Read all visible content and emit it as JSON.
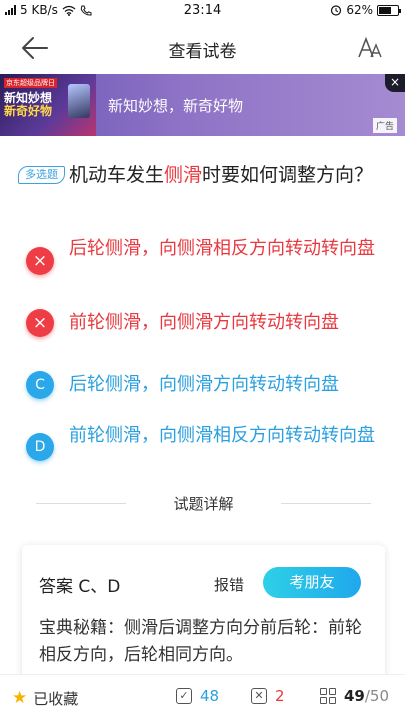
{
  "status_bar": {
    "network": "5 KB/s",
    "time": "23:14",
    "battery": "62%"
  },
  "header": {
    "title": "查看试卷"
  },
  "ad": {
    "thumb_tag": "京东超级品牌日",
    "thumb_line1": "新知妙想",
    "thumb_line2": "新奇好物",
    "text": "新知妙想，新奇好物",
    "label": "广告",
    "close": "×"
  },
  "question": {
    "type_badge": "多选题",
    "text_before": "机动车发生",
    "highlight": "侧滑",
    "text_after": "时要如何调整方向？"
  },
  "options": [
    {
      "marker": "×",
      "text": "后轮侧滑，向侧滑相反方向转动转向盘",
      "state": "wrong"
    },
    {
      "marker": "×",
      "text": "前轮侧滑，向侧滑方向转动转向盘",
      "state": "wrong"
    },
    {
      "marker": "C",
      "text": "后轮侧滑，向侧滑方向转动转向盘",
      "state": "plain"
    },
    {
      "marker": "D",
      "text": "前轮侧滑，向侧滑相反方向转动转向盘",
      "state": "plain"
    }
  ],
  "detail_divider": "试题详解",
  "explanation": {
    "answer": "答案  C、D",
    "report_label": "报错",
    "friend_button": "考朋友",
    "tips_title": "宝典秘籍：",
    "tips_text": "侧滑后调整方向分前后轮：前轮相反方向，后轮相同方向。"
  },
  "bottom_bar": {
    "favorite_label": "已收藏",
    "correct_count": "48",
    "wrong_count": "2",
    "progress_current": "49",
    "progress_total": "/50"
  },
  "colors": {
    "wrong": "#e7393f",
    "primary": "#2aa0de",
    "star": "#f5b400"
  }
}
